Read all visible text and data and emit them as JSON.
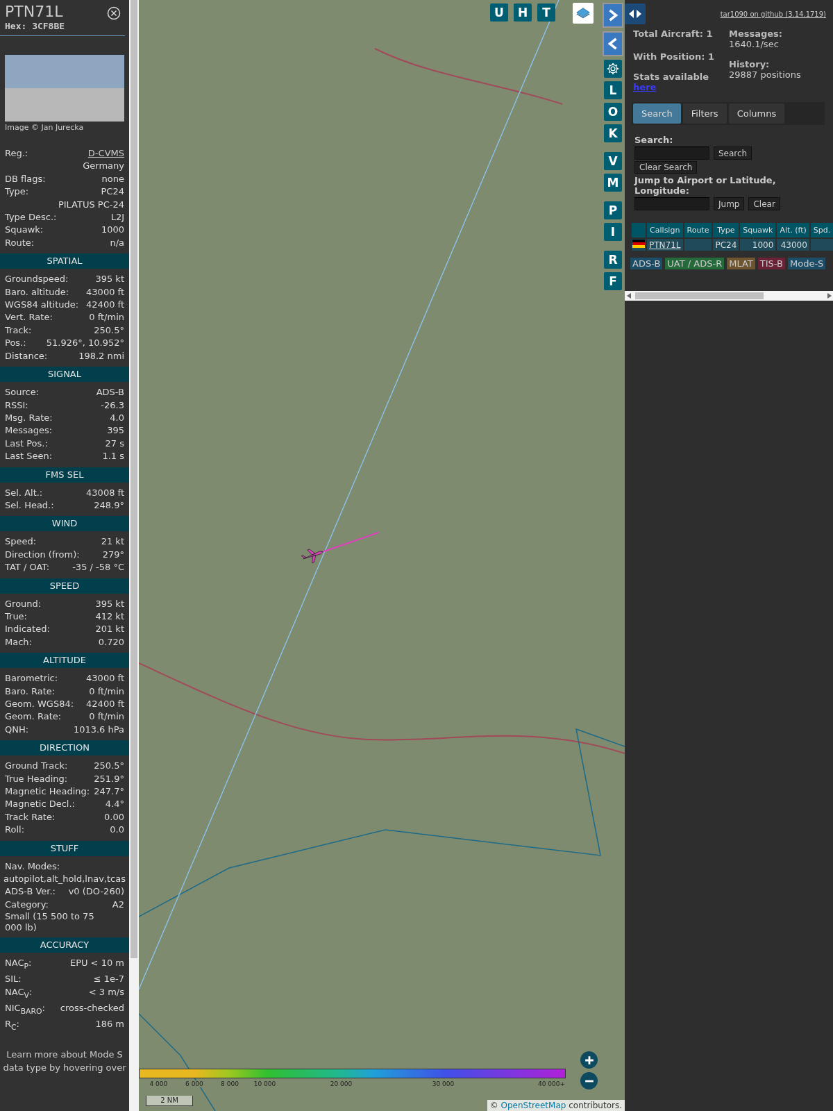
{
  "sidebar": {
    "callsign": "PTN71L",
    "hex": "Hex: 3CF8BE",
    "photo_credit": "Image © Jan Jurecka",
    "info_rows": [
      {
        "kind": "pair",
        "label": "Reg.:",
        "value": "D-CVMS",
        "link": true
      },
      {
        "kind": "value",
        "value": "Germany"
      },
      {
        "kind": "pair",
        "label": "DB flags:",
        "value": "none"
      },
      {
        "kind": "pair",
        "label": "Type:",
        "value": "PC24"
      },
      {
        "kind": "value",
        "value": "PILATUS PC-24"
      },
      {
        "kind": "pair",
        "label": "Type Desc.:",
        "value": "L2J"
      },
      {
        "kind": "pair",
        "label": "Squawk:",
        "value": "1000"
      },
      {
        "kind": "pair",
        "label": "Route:",
        "value": "n/a"
      }
    ],
    "sections": [
      {
        "title": "SPATIAL",
        "rows": [
          {
            "kind": "pair",
            "label": "Groundspeed:",
            "value": "395 kt"
          },
          {
            "kind": "pair",
            "label": "Baro. altitude:",
            "value": "43000 ft"
          },
          {
            "kind": "pair",
            "label": "WGS84 altitude:",
            "value": "42400 ft"
          },
          {
            "kind": "pair",
            "label": "Vert. Rate:",
            "value": "0 ft/min"
          },
          {
            "kind": "pair",
            "label": "Track:",
            "value": "250.5°"
          },
          {
            "kind": "pair",
            "label": "Pos.:",
            "value": "51.926°, 10.952°"
          },
          {
            "kind": "pair",
            "label": "Distance:",
            "value": "198.2 nmi"
          }
        ]
      },
      {
        "title": "SIGNAL",
        "rows": [
          {
            "kind": "pair",
            "label": "Source:",
            "value": "ADS-B"
          },
          {
            "kind": "pair",
            "label": "RSSI:",
            "value": "-26.3"
          },
          {
            "kind": "pair",
            "label": "Msg. Rate:",
            "value": "4.0"
          },
          {
            "kind": "pair",
            "label": "Messages:",
            "value": "395"
          },
          {
            "kind": "pair",
            "label": "Last Pos.:",
            "value": "27 s"
          },
          {
            "kind": "pair",
            "label": "Last Seen:",
            "value": "1.1 s"
          }
        ]
      },
      {
        "title": "FMS SEL",
        "rows": [
          {
            "kind": "pair",
            "label": "Sel. Alt.:",
            "value": "43008 ft"
          },
          {
            "kind": "pair",
            "label": "Sel. Head.:",
            "value": "248.9°"
          }
        ]
      },
      {
        "title": "WIND",
        "rows": [
          {
            "kind": "pair",
            "label": "Speed:",
            "value": "21 kt"
          },
          {
            "kind": "pair",
            "label": "Direction (from):",
            "value": "279°"
          },
          {
            "kind": "pair",
            "label": "TAT / OAT:",
            "value": "-35 / -58 °C"
          }
        ]
      },
      {
        "title": "SPEED",
        "rows": [
          {
            "kind": "pair",
            "label": "Ground:",
            "value": "395 kt"
          },
          {
            "kind": "pair",
            "label": "True:",
            "value": "412 kt"
          },
          {
            "kind": "pair",
            "label": "Indicated:",
            "value": "201 kt"
          },
          {
            "kind": "pair",
            "label": "Mach:",
            "value": "0.720"
          }
        ]
      },
      {
        "title": "ALTITUDE",
        "rows": [
          {
            "kind": "pair",
            "label": "Barometric:",
            "value": "43000 ft"
          },
          {
            "kind": "pair",
            "label": "Baro. Rate:",
            "value": "0 ft/min"
          },
          {
            "kind": "pair",
            "label": "Geom. WGS84:",
            "value": "42400 ft"
          },
          {
            "kind": "pair",
            "label": "Geom. Rate:",
            "value": "0 ft/min"
          },
          {
            "kind": "pair",
            "label": "QNH:",
            "value": "1013.6 hPa"
          }
        ]
      },
      {
        "title": "DIRECTION",
        "rows": [
          {
            "kind": "pair",
            "label": "Ground Track:",
            "value": "250.5°"
          },
          {
            "kind": "pair",
            "label": "True Heading:",
            "value": "251.9°"
          },
          {
            "kind": "pair",
            "label": "Magnetic Heading:",
            "value": "247.7°"
          },
          {
            "kind": "pair",
            "label": "Magnetic Decl.:",
            "value": "4.4°"
          },
          {
            "kind": "pair",
            "label": "Track Rate:",
            "value": "0.00"
          },
          {
            "kind": "pair",
            "label": "Roll:",
            "value": "0.0"
          }
        ]
      },
      {
        "title": "STUFF",
        "rows": [
          {
            "kind": "label",
            "label": "Nav. Modes:"
          },
          {
            "kind": "centered",
            "value": "autopilot,alt_hold,lnav,tcas"
          },
          {
            "kind": "pair",
            "label": "ADS-B Ver.:",
            "value": "v0 (DO-260)"
          },
          {
            "kind": "pair",
            "label": "Category:",
            "value": "A2"
          },
          {
            "kind": "note",
            "value": "Small (15 500 to 75 000 lb)"
          }
        ]
      },
      {
        "title": "ACCURACY",
        "rows": [
          {
            "kind": "pair",
            "label": "NAC$_{P}$:",
            "value": "EPU < 10 m"
          },
          {
            "kind": "pair",
            "label": "SIL:",
            "value": "≤ 1e-7"
          },
          {
            "kind": "pair",
            "label": "NAC$_{V}$:",
            "value": "< 3 m/s"
          },
          {
            "kind": "pair",
            "label": "NIC$_{BARO}$:",
            "value": "cross-checked"
          },
          {
            "kind": "pair",
            "label": "R$_{C}$:",
            "value": "186 m"
          }
        ]
      }
    ],
    "footer_note": "Learn more about Mode S data type by hovering over"
  },
  "map": {
    "top_buttons": [
      "U",
      "H",
      "T"
    ],
    "side_buttons": [
      [
        "L",
        "O",
        "K"
      ],
      [
        "V",
        "M"
      ],
      [
        "P",
        "I"
      ],
      [
        "R",
        "F"
      ]
    ],
    "legend": [
      "4 000",
      "6 000",
      "8 000",
      "10 000",
      "20 000",
      "30 000",
      "40 000+"
    ],
    "scale": "2 NM",
    "attribution": {
      "prefix": "©",
      "link": "OpenStreetMap",
      "suffix": "contributors."
    }
  },
  "panel": {
    "github_link": "tar1090 on github (3.14.1719)",
    "stats": {
      "total": "Total Aircraft: 1",
      "with_position": "With Position: 1",
      "stats_text": "Stats available",
      "stats_link": "here",
      "messages_label": "Messages:",
      "messages_value": "1640.1/sec",
      "history_label": "History:",
      "history_value": "29887 positions"
    },
    "tabs": [
      {
        "label": "Search",
        "selected": true
      },
      {
        "label": "Filters",
        "selected": false
      },
      {
        "label": "Columns",
        "selected": false
      }
    ],
    "search": {
      "label": "Search:",
      "search_button": "Search",
      "clear_button": "Clear Search",
      "jump_label": "Jump to Airport or Latitude, Longitude:",
      "jump_button": "Jump",
      "jump_clear_button": "Clear"
    },
    "table": {
      "columns": [
        "Callsign",
        "Route",
        "Type",
        "Squawk",
        "Alt. (ft)",
        "Spd."
      ],
      "rows": [
        {
          "callsign": "PTN71L",
          "type": "PC24",
          "squawk": "1000",
          "altitude": "43000"
        }
      ]
    },
    "sources": [
      {
        "label": "ADS-B",
        "color": "#1d4c66"
      },
      {
        "label": "UAT / ADS-R",
        "color": "#256a3a"
      },
      {
        "label": "MLAT",
        "color": "#6e5530"
      },
      {
        "label": "TIS-B",
        "color": "#6a2236"
      },
      {
        "label": "Mode-S",
        "color": "#1d4c66"
      }
    ]
  }
}
